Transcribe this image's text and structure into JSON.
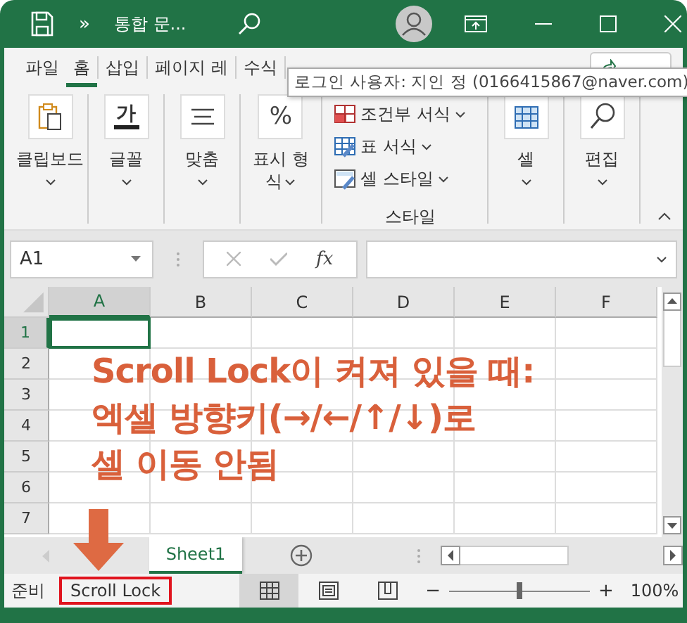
{
  "title_bar": {
    "quick_more": "»",
    "title": "통합 문..."
  },
  "ribbon_tabs": [
    {
      "label": "파일",
      "selected": false
    },
    {
      "label": "홈",
      "selected": true
    },
    {
      "label": "삽입",
      "selected": false
    },
    {
      "label": "페이지 레",
      "selected": false
    },
    {
      "label": "수식",
      "selected": false
    }
  ],
  "tooltip": "로그인 사용자: 지인 정 (0166415867@naver.com)",
  "ribbon_groups": [
    {
      "kind": "big",
      "label": "클립보드"
    },
    {
      "kind": "big",
      "glyph": "가",
      "label": "글꼴"
    },
    {
      "kind": "big",
      "label": "맞춤"
    },
    {
      "kind": "big",
      "glyph": "%",
      "label": "표시 형",
      "label_2": "식"
    },
    {
      "kind": "list",
      "label": "스타일",
      "items": [
        {
          "label": "조건부 서식"
        },
        {
          "label": "표 서식"
        },
        {
          "label": "셀 스타일"
        }
      ]
    },
    {
      "kind": "big",
      "label": "셀"
    },
    {
      "kind": "big",
      "label": "편집"
    }
  ],
  "name_box": "A1",
  "formula_bar": {
    "function_label": "fx"
  },
  "columns": [
    {
      "label": "A",
      "selected": true
    },
    {
      "label": "B",
      "selected": false
    },
    {
      "label": "C",
      "selected": false
    },
    {
      "label": "D",
      "selected": false
    },
    {
      "label": "E",
      "selected": false
    },
    {
      "label": "F",
      "selected": false
    }
  ],
  "rows": [
    {
      "label": "1",
      "selected": true
    },
    {
      "label": "2",
      "selected": false
    },
    {
      "label": "3",
      "selected": false
    },
    {
      "label": "4",
      "selected": false
    },
    {
      "label": "5",
      "selected": false
    },
    {
      "label": "6",
      "selected": false
    },
    {
      "label": "7",
      "selected": false
    }
  ],
  "annotation": [
    "Scroll Lock이 켜져 있을 때:",
    "엑셀 방향키(→/←/↑/↓)로",
    "셀 이동 안됨"
  ],
  "sheets": [
    {
      "label": "Sheet1",
      "selected": true
    }
  ],
  "status_bar": {
    "ready": "준비",
    "scroll_lock": "Scroll Lock",
    "views": [
      {
        "selected": true
      },
      {
        "selected": false
      },
      {
        "selected": false
      }
    ],
    "zoom_minus": "−",
    "zoom_plus": "+",
    "zoom": {
      "level": 0.5
    },
    "zoom_text": "100%"
  }
}
